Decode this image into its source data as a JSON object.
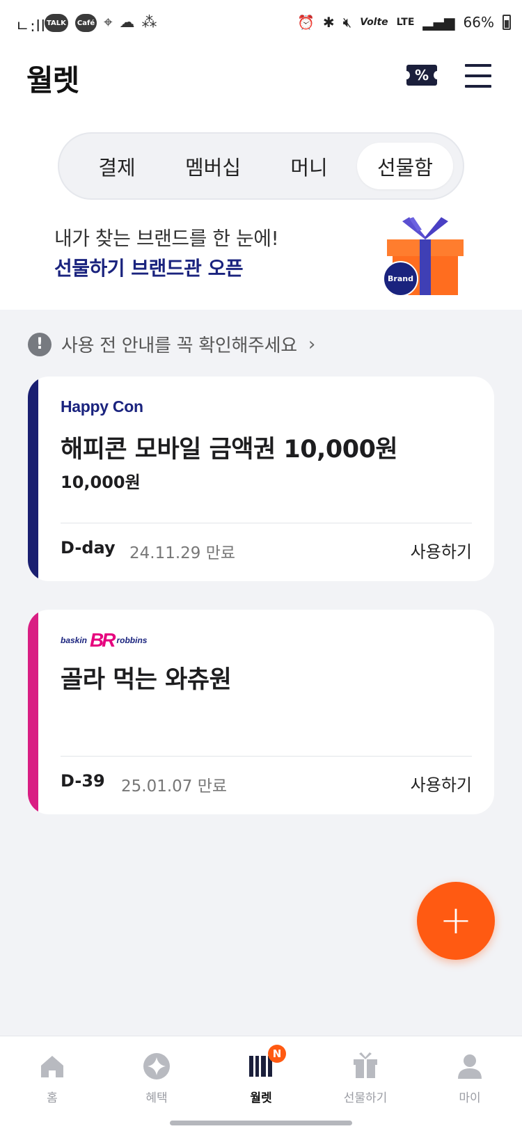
{
  "status_bar": {
    "time": "ㄴ:ll",
    "talk_label": "TALK",
    "cafe_label": "Café",
    "network": "LTE",
    "volte": "Volte",
    "battery": "66%"
  },
  "header": {
    "title": "월렛",
    "coupon_icon": "%"
  },
  "tabs": [
    {
      "label": "결제",
      "active": false
    },
    {
      "label": "멤버십",
      "active": false
    },
    {
      "label": "머니",
      "active": false
    },
    {
      "label": "선물함",
      "active": true
    }
  ],
  "banner": {
    "line1": "내가 찾는 브랜드를 한 눈에!",
    "line2": "선물하기 브랜드관 오픈",
    "badge": "Brand"
  },
  "notice": {
    "icon": "!",
    "text": "사용 전 안내를 꼭 확인해주세요",
    "chevron": "›"
  },
  "cards": [
    {
      "brand": "Happy Con",
      "title": "해피콘 모바일 금액권 10,000원",
      "amount": "10,000원",
      "dday": "D-day",
      "expiry": "24.11.29  만료",
      "action": "사용하기",
      "stripe_color": "#1a1f71"
    },
    {
      "brand_left": "baskin",
      "brand_mark": "BR",
      "brand_right": "robbins",
      "title": "골라 먹는 와츄원",
      "dday": "D-39",
      "expiry": "25.01.07  만료",
      "action": "사용하기",
      "stripe_color": "#d91e83"
    }
  ],
  "fab": {
    "label": "+"
  },
  "bottom_nav": {
    "items": [
      {
        "label": "홈",
        "icon": "home-icon"
      },
      {
        "label": "혜택",
        "icon": "sparkle-icon"
      },
      {
        "label": "월렛",
        "icon": "wallet-icon",
        "active": true,
        "badge": "N"
      },
      {
        "label": "선물하기",
        "icon": "gift-icon"
      },
      {
        "label": "마이",
        "icon": "person-icon"
      }
    ]
  },
  "colors": {
    "accent": "#ff5a12",
    "navy": "#1a237e",
    "background": "#f2f3f6"
  }
}
